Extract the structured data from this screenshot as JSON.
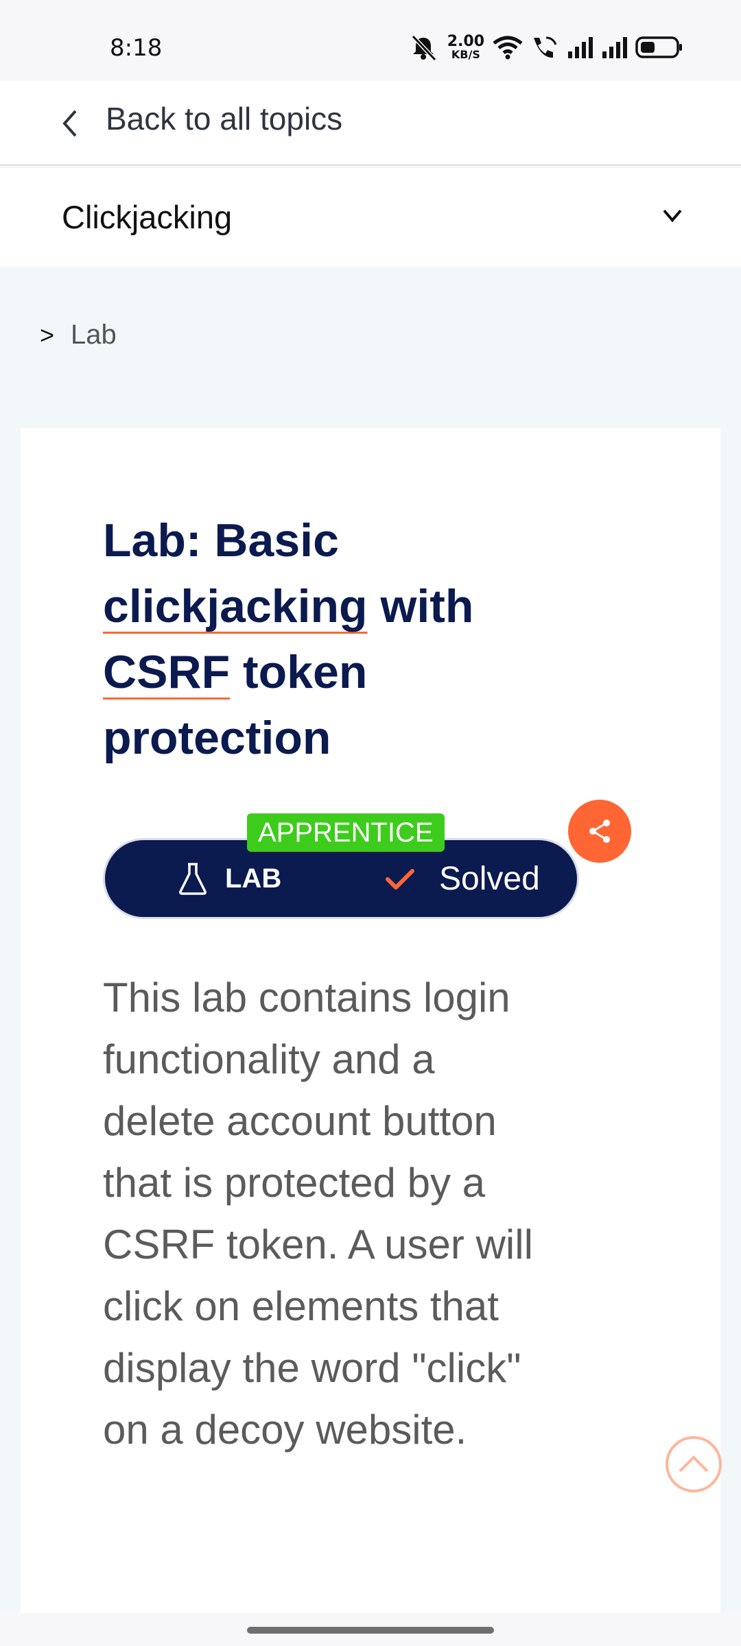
{
  "status_bar": {
    "time": "8:18",
    "speed_value": "2.00",
    "speed_unit": "KB/S"
  },
  "nav": {
    "back_label": "Back to all topics",
    "topic_title": "Clickjacking"
  },
  "breadcrumb": {
    "separator": ">",
    "label": "Lab"
  },
  "lab": {
    "title_part1": "Lab: Basic ",
    "title_link1": "clickjacking",
    "title_part2": " with ",
    "title_link2": "CSRF",
    "title_part3": " token protection",
    "level_badge": "APPRENTICE",
    "type_label": "LAB",
    "status_label": "Solved",
    "description": "This lab contains login functionality and a delete account button that is protected by a CSRF token. A user will click on elements that display the word \"click\" on a decoy website."
  },
  "colors": {
    "navy": "#0b1a4f",
    "accent_orange": "#ff6633",
    "badge_green": "#3ecc1c"
  },
  "icons": {
    "back": "chevron-left-icon",
    "topic_toggle": "chevron-down-icon",
    "lab": "flask-icon",
    "solved": "check-icon",
    "fab": "share-icon",
    "scroll_top": "chevron-up-icon"
  }
}
